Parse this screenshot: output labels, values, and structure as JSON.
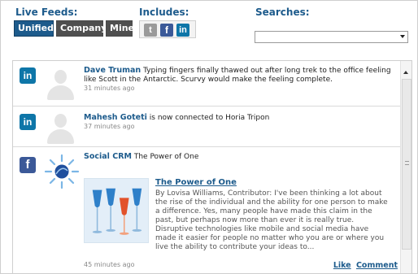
{
  "header": {
    "live_feeds_label": "Live Feeds:",
    "includes_label": "Includes:",
    "searches_label": "Searches:",
    "tabs": [
      {
        "label": "Unified",
        "active": true
      },
      {
        "label": "Company",
        "active": false
      },
      {
        "label": "Mine",
        "active": false
      }
    ],
    "includes_icons": [
      {
        "icon": "twitter-icon",
        "glyph": "t"
      },
      {
        "icon": "facebook-icon",
        "glyph": "f"
      },
      {
        "icon": "linkedin-icon",
        "glyph": "in"
      }
    ],
    "search_selected": ""
  },
  "feed": {
    "items": [
      {
        "network_icon": "linkedin-icon",
        "network_glyph": "in",
        "author": "Dave Truman",
        "text": " Typing fingers finally thawed out after long trek to the office feeling like Scott in the Antarctic. Scurvy would make the feeling complete.",
        "time": "31 minutes ago"
      },
      {
        "network_icon": "linkedin-icon",
        "network_glyph": "in",
        "author": "Mahesh Goteti",
        "text": " is now connected to Horia Tripon",
        "time": "37 minutes ago"
      },
      {
        "network_icon": "facebook-icon",
        "network_glyph": "f",
        "author": "Social CRM",
        "text": " The Power of One",
        "article_title": "The Power of One",
        "article_body": "By Lovisa Williams, Contributor: I've been thinking a lot about the rise of the individual and the ability for one person to make a difference.  Yes, many people have made this claim in the past, but perhaps now more than ever it is really true. Disruptive technologies like mobile and social media have made it easier for people no matter who you are or where you live the ability to contribute your ideas to...",
        "time": "45 minutes ago",
        "like_label": "Like",
        "comment_label": "Comment"
      }
    ]
  },
  "colors": {
    "accent": "#1d5b8c",
    "linkedin": "#0e76a8",
    "facebook": "#3b5998",
    "tab_inactive": "#4f4f4f"
  }
}
